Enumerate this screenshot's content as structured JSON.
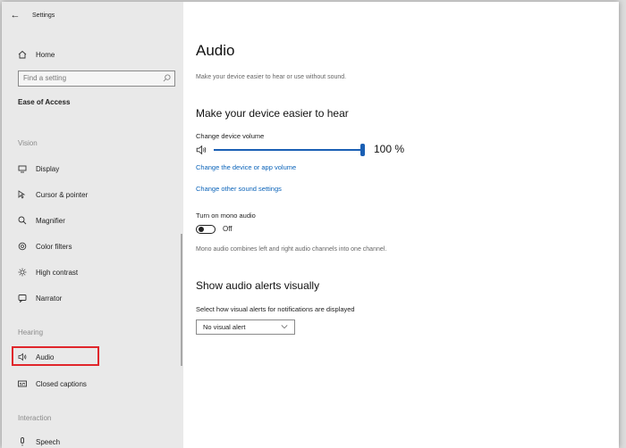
{
  "window": {
    "back_glyph": "←",
    "title": "Settings"
  },
  "sidebar": {
    "home_label": "Home",
    "search_placeholder": "Find a setting",
    "category": "Ease of Access",
    "vision_header": "Vision",
    "vision_items": [
      {
        "label": "Display",
        "icon": "display-icon"
      },
      {
        "label": "Cursor & pointer",
        "icon": "cursor-icon"
      },
      {
        "label": "Magnifier",
        "icon": "magnifier-icon"
      },
      {
        "label": "Color filters",
        "icon": "color-filter-icon"
      },
      {
        "label": "High contrast",
        "icon": "high-contrast-icon"
      },
      {
        "label": "Narrator",
        "icon": "narrator-icon"
      }
    ],
    "hearing_header": "Hearing",
    "hearing_items": [
      {
        "label": "Audio",
        "icon": "speaker-icon",
        "selected": true
      },
      {
        "label": "Closed captions",
        "icon": "closed-captions-icon"
      }
    ],
    "interaction_header": "Interaction",
    "interaction_items": [
      {
        "label": "Speech",
        "icon": "microphone-icon"
      }
    ]
  },
  "main": {
    "title": "Audio",
    "subtitle": "Make your device easier to hear or use without sound.",
    "section1_title": "Make your device easier to hear",
    "volume_label": "Change device volume",
    "volume_value": "100 %",
    "volume_level": 1.0,
    "link_app_volume": "Change the device or app volume",
    "link_sound_settings": "Change other sound settings",
    "mono_label": "Turn on mono audio",
    "mono_state": "Off",
    "mono_description": "Mono audio combines left and right audio channels into one channel.",
    "section2_title": "Show audio alerts visually",
    "alerts_label": "Select how visual alerts for notifications are displayed",
    "alerts_selected": "No visual alert"
  },
  "colors": {
    "accent": "#1a5fb4",
    "highlight": "#e0262b",
    "link": "#0a63b9",
    "sidebar_bg": "#e9e9e9"
  }
}
